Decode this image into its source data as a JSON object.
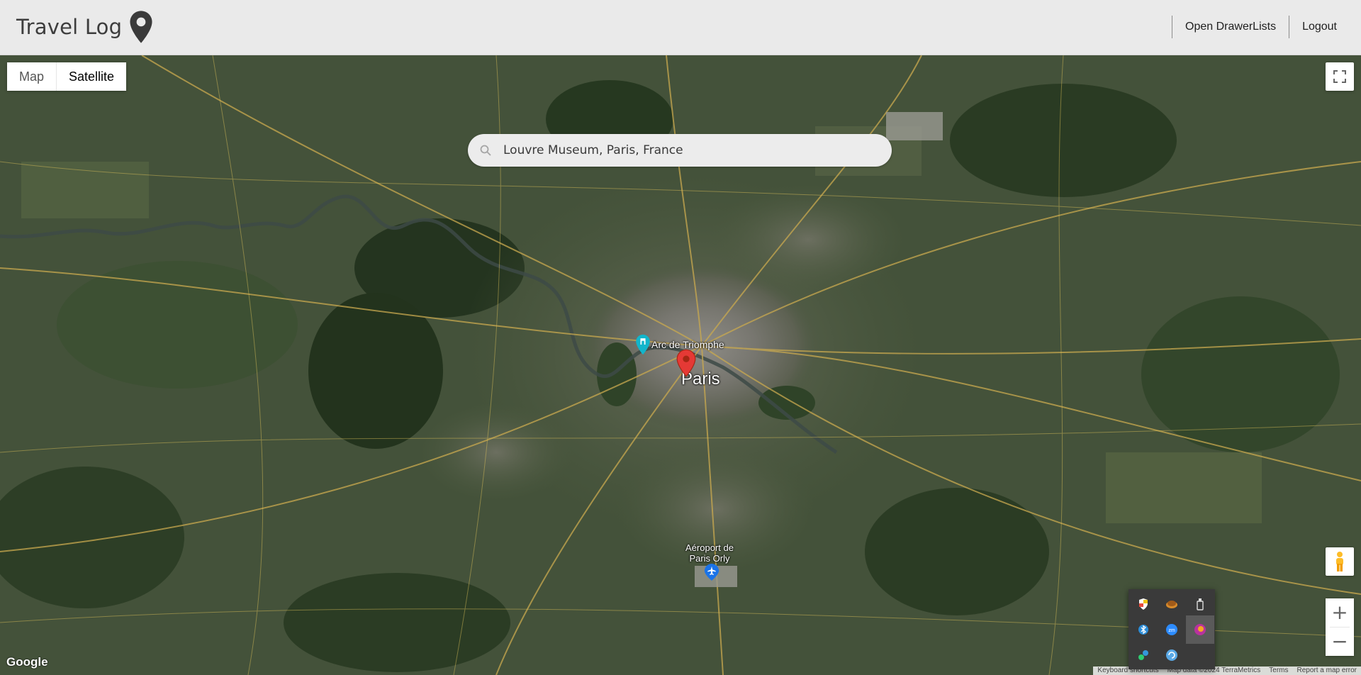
{
  "app": {
    "title": "Travel Log",
    "brand_icon": "map-pin-icon"
  },
  "nav": {
    "open_drawer_label": "Open DrawerLists",
    "logout_label": "Logout"
  },
  "map": {
    "map_type": {
      "map_label": "Map",
      "satellite_label": "Satellite",
      "selected": "Satellite"
    },
    "search": {
      "value": "Louvre Museum, Paris, France",
      "icon": "search-icon"
    },
    "labels": {
      "city": "Paris",
      "landmark": "Arc de Triomphe",
      "airport_line1": "Aéroport de",
      "airport_line2": "Paris Orly"
    },
    "controls": {
      "fullscreen_icon": "fullscreen-icon",
      "pegman_icon": "pegman-icon",
      "zoom_in_label": "+",
      "zoom_out_label": "−"
    },
    "logo": "Google",
    "attribution": {
      "shortcuts": "Keyboard shortcuts",
      "data": "Map data ©2024 TerraMetrics",
      "terms": "Terms",
      "report": "Report a map error"
    }
  },
  "colors": {
    "marker_red": "#e53935",
    "marker_teal": "#12b5cb",
    "airport_blue": "#1a73e8"
  },
  "tray": {
    "icons": [
      "security-icon",
      "cloud-icon",
      "usb-icon",
      "bluetooth-icon",
      "zoom-icon",
      "app-icon",
      "network-icon",
      "update-icon"
    ]
  }
}
